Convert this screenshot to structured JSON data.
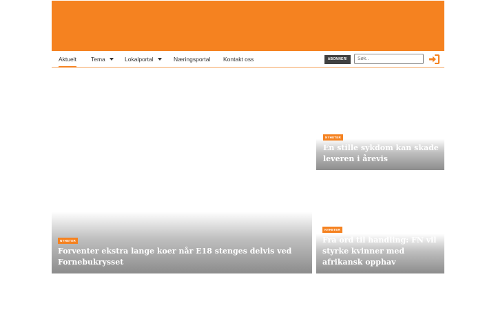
{
  "colors": {
    "brand": "#f58220",
    "subscribe_bg": "#404040"
  },
  "nav": {
    "items": [
      {
        "label": "Aktuelt",
        "active": true
      },
      {
        "label": "Tema",
        "dropdown": true
      },
      {
        "label": "Lokalportal",
        "dropdown": true
      },
      {
        "label": "Næringsportal"
      },
      {
        "label": "Kontakt oss"
      }
    ],
    "subscribe_label": "ABONNER!",
    "search_placeholder": "Søk..",
    "login_icon": "sign-in-icon"
  },
  "articles": [
    {
      "tag": "NYHETER",
      "title": "En stille sykdom kan skade leveren i årevis"
    },
    {
      "tag": "NYHETER",
      "title": "Forventer ekstra lange koer når E18 stenges delvis ved Fornebukrysset"
    },
    {
      "tag": "NYHETER",
      "title": "Fra ord til handling: FN vil styrke kvinner med afrikansk opphav"
    }
  ]
}
